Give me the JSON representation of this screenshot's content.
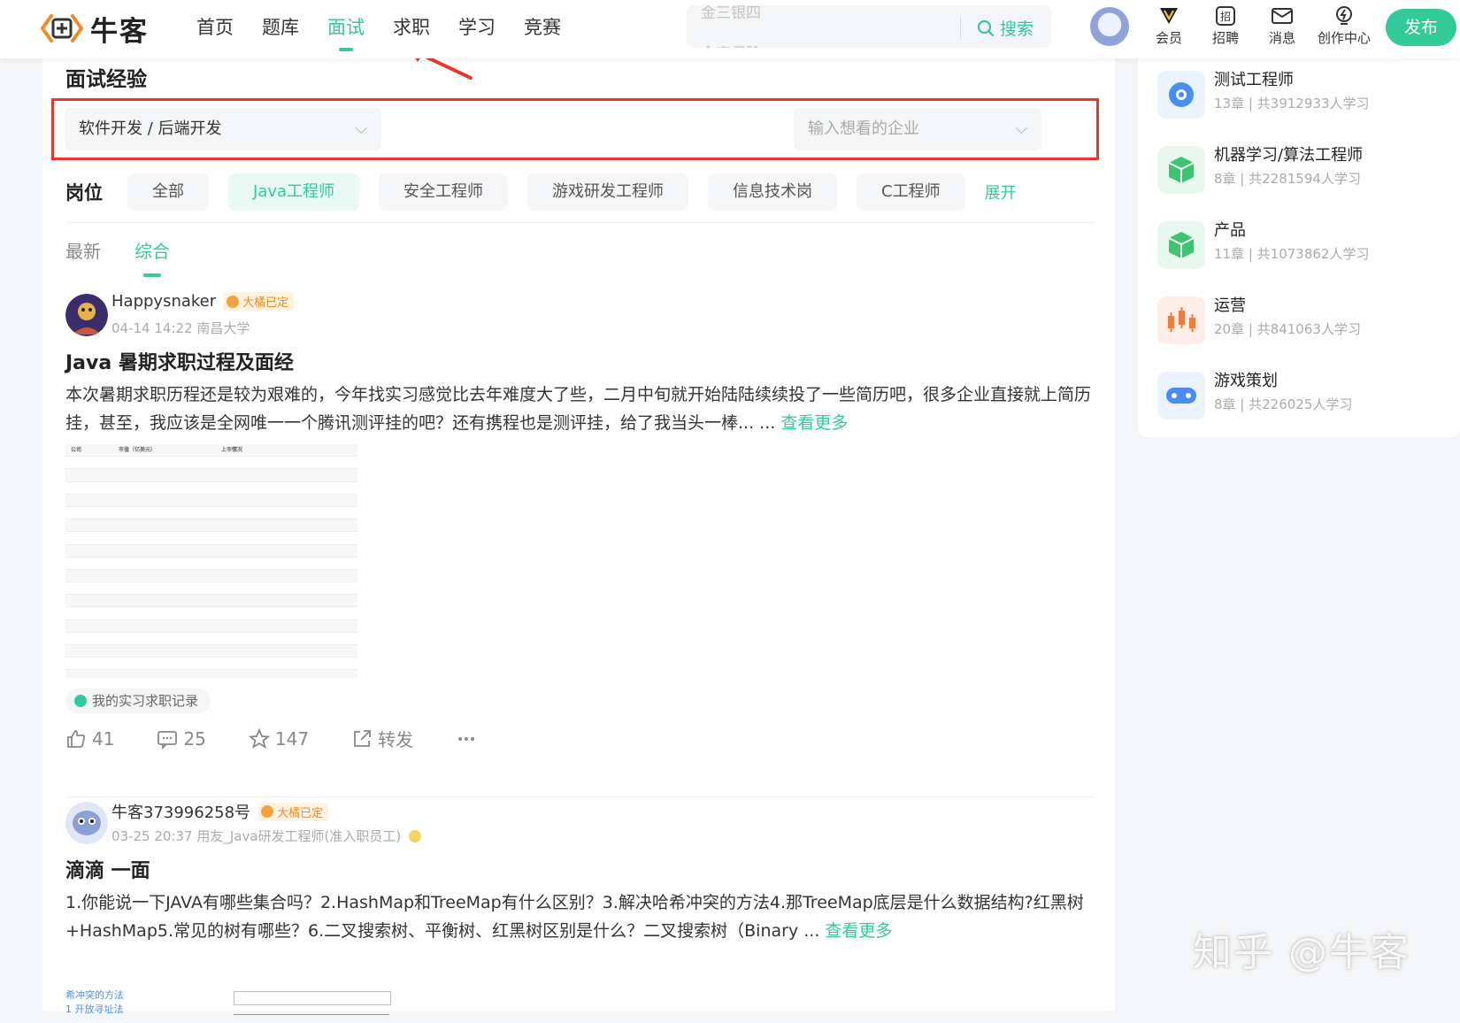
{
  "brand": {
    "name": "牛客",
    "accent": "#32ca99",
    "highlight": "#e8372a"
  },
  "nav": {
    "items": [
      "首页",
      "题库",
      "面试",
      "求职",
      "学习",
      "竞赛"
    ],
    "active": "面试"
  },
  "search": {
    "placeholder_line1": "金三银四",
    "placeholder_line2": "全完保险",
    "button": "搜索"
  },
  "top_actions": {
    "vip": "会员",
    "recruit": "招聘",
    "messages": "消息",
    "creator": "创作中心",
    "publish": "发布"
  },
  "page": {
    "title": "面试经验"
  },
  "filters": {
    "category": "软件开发 / 后端开发",
    "company_placeholder": "输入想看的企业"
  },
  "tags": {
    "label": "岗位",
    "items": [
      "全部",
      "Java工程师",
      "安全工程师",
      "游戏研发工程师",
      "信息技术岗",
      "C工程师"
    ],
    "active": "Java工程师",
    "expand": "展开"
  },
  "sort_tabs": {
    "items": [
      "最新",
      "综合"
    ],
    "active": "综合"
  },
  "posts": [
    {
      "user": "Happysnaker",
      "badge": "大橘已定",
      "meta": "04-14 14:22   南昌大学",
      "title": "Java 暑期求职过程及面经",
      "body": "本次暑期求职历程还是较为艰难的，今年找实习感觉比去年难度大了些，二月中旬就开始陆陆续续投了一些简历吧，很多企业直接就上简历挂，甚至，我应该是全网唯一一个腾讯测评挂的吧？还有携程也是测评挂，给了我当头一棒... ...",
      "more": "查看更多",
      "topic": "我的实习求职记录",
      "likes": "41",
      "comments": "25",
      "stars": "147",
      "share": "转发",
      "thumb_header": [
        "公司",
        "市值（亿美元）",
        "上市情况"
      ]
    },
    {
      "user": "牛客373996258号",
      "badge": "大橘已定",
      "meta": "03-25 20:37   用友_Java研发工程师(准入职员工)",
      "title": "滴滴 一面",
      "body": "1.你能说一下JAVA有哪些集合吗？2.HashMap和TreeMap有什么区别？3.解决哈希冲突的方法4.那TreeMap底层是什么数据结构?红黑树+HashMap5.常见的树有哪些？6.二叉搜索树、平衡树、红黑树区别是什么？二叉搜索树（Binary ...",
      "more": "查看更多",
      "thumb_text1": "希冲突的方法",
      "thumb_text2": "1 开放寻址法"
    }
  ],
  "courses": [
    {
      "title": "测试工程师",
      "sub": "13章 | 共3912933人学习",
      "icon": "target-icon",
      "color": "#4a8df0"
    },
    {
      "title": "机器学习/算法工程师",
      "sub": "8章 | 共2281594人学习",
      "icon": "cube-icon",
      "color": "#3cc46e"
    },
    {
      "title": "产品",
      "sub": "11章 | 共1073862人学习",
      "icon": "cube-icon",
      "color": "#3cc46e"
    },
    {
      "title": "运营",
      "sub": "20章 | 共841063人学习",
      "icon": "candlestick-icon",
      "color": "#f07a3c"
    },
    {
      "title": "游戏策划",
      "sub": "8章 | 共226025人学习",
      "icon": "gamepad-icon",
      "color": "#4a8df0"
    }
  ],
  "watermark": "知乎 @牛客"
}
